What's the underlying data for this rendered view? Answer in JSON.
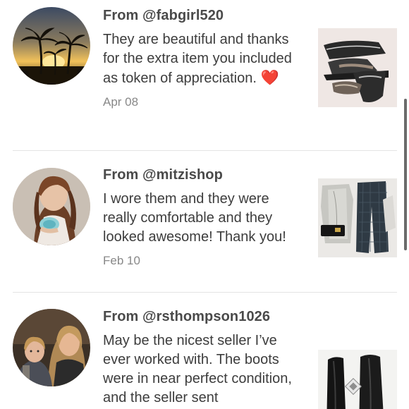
{
  "reviews": [
    {
      "from": "From @fabgirl520",
      "text": "They are beautiful and thanks for the extra item you included as token of appreciation.",
      "emoji": "❤️",
      "date": "Apr 08"
    },
    {
      "from": "From @mitzishop",
      "text": "I wore them and they were really comfortable and they looked awesome! Thank you!",
      "date": "Feb 10"
    },
    {
      "from": "From @rsthompson1026",
      "text": "May be the nicest seller I’ve ever worked with. The boots were in near perfect condition, and the seller sent"
    }
  ]
}
